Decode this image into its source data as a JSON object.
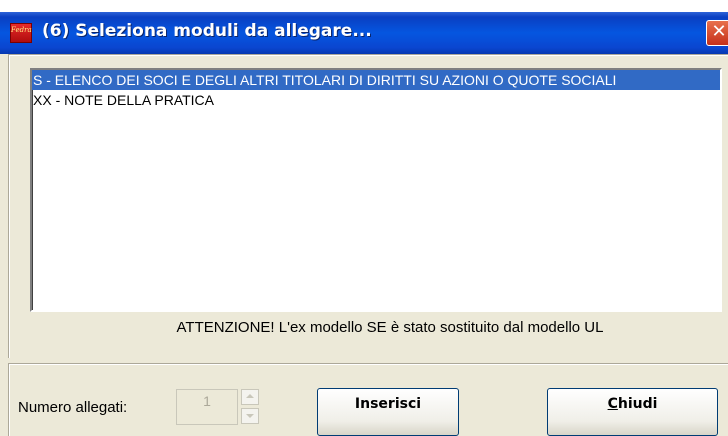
{
  "window": {
    "title": "(6) Seleziona moduli da allegare...",
    "close_glyph": "✕",
    "app_icon": "fedra-app-icon",
    "app_icon_text": "Fedra"
  },
  "modules_list": {
    "items": [
      {
        "label": "S - ELENCO DEI SOCI E DEGLI ALTRI TITOLARI DI DIRITTI SU AZIONI O QUOTE SOCIALI",
        "selected": true
      },
      {
        "label": "XX - NOTE DELLA PRATICA",
        "selected": false
      }
    ]
  },
  "notice": "ATTENZIONE! L'ex modello SE è stato sostituito dal modello UL",
  "footer": {
    "attachments_label": "Numero allegati:",
    "attachments_value": "1",
    "insert_label": "Inserisci",
    "close_label_first": "C",
    "close_label_rest": "hiudi"
  },
  "colors": {
    "titlebar": "#0556e0",
    "selection": "#316ac5",
    "dialog_bg": "#ece9d8",
    "close_button": "#c5301a"
  }
}
